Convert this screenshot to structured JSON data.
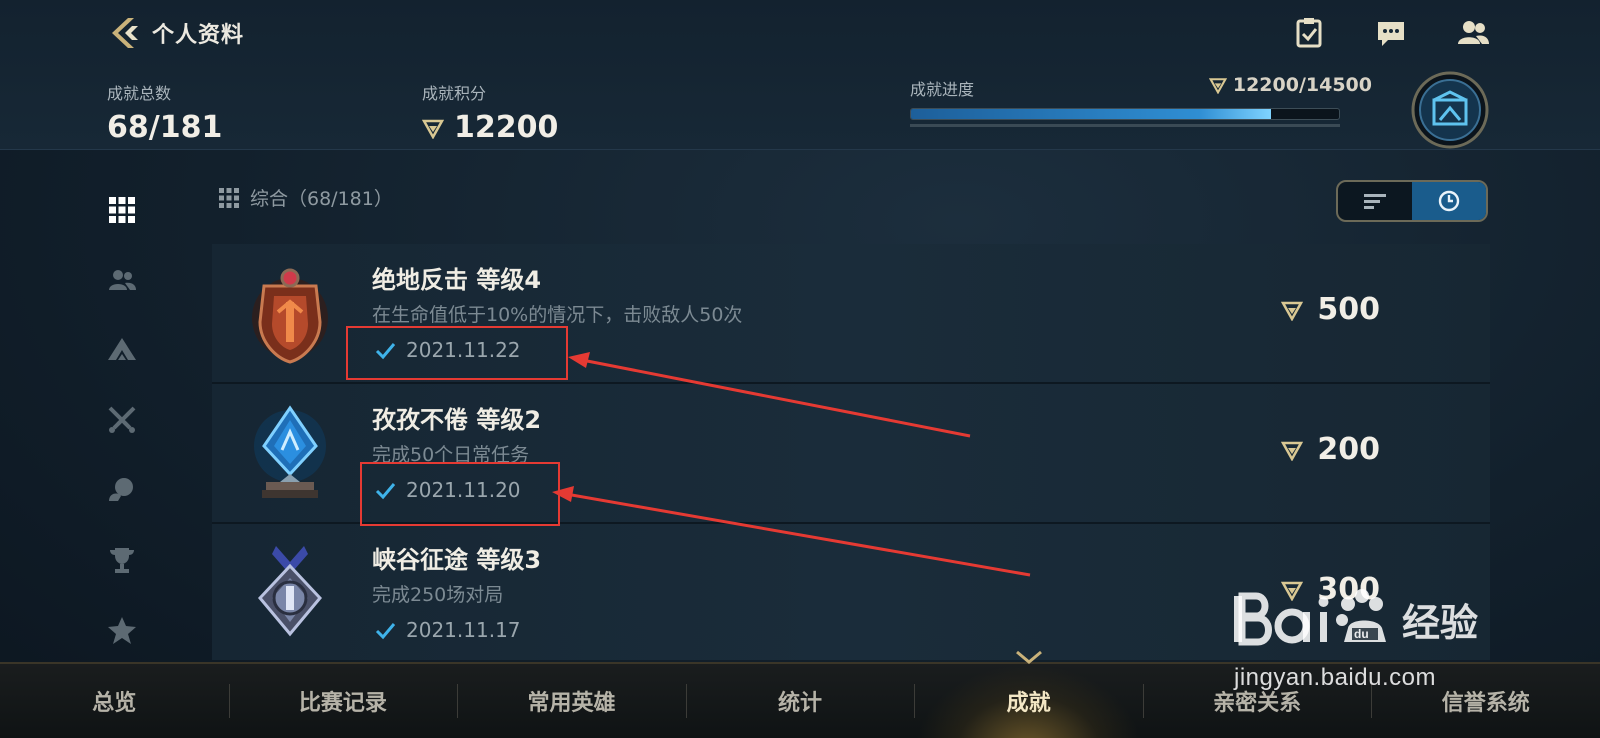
{
  "header": {
    "title": "个人资料",
    "icons": [
      "task-check-icon",
      "chat-icon",
      "friends-icon"
    ]
  },
  "stats": {
    "total_label": "成就总数",
    "total_value": "68/181",
    "points_label": "成就积分",
    "points_value": "12200",
    "progress_label": "成就进度",
    "progress_text": "12200/14500",
    "progress_fraction": 0.841
  },
  "sidebar": {
    "items": [
      "grid-icon",
      "team-icon",
      "rank-up-icon",
      "crossed-swords-icon",
      "social-icon",
      "trophy-icon",
      "star-icon"
    ],
    "active_index": 0
  },
  "filter": {
    "label": "综合（68/181）"
  },
  "sort_toggle": {
    "options": [
      "sort-list-icon",
      "clock-icon"
    ],
    "active_index": 1
  },
  "achievements": [
    {
      "title": "绝地反击  等级4",
      "desc": "在生命值低于10%的情况下，击败敌人50次",
      "date": "2021.11.22",
      "points": "500",
      "badge_color": "#b54a2b"
    },
    {
      "title": "孜孜不倦  等级2",
      "desc": "完成50个日常任务",
      "date": "2021.11.20",
      "points": "200",
      "badge_color": "#2b8fe0"
    },
    {
      "title": "峡谷征途  等级3",
      "desc": "完成250场对局",
      "date": "2021.11.17",
      "points": "300",
      "badge_color": "#7a86a8"
    }
  ],
  "tabs": {
    "items": [
      "总览",
      "比赛记录",
      "常用英雄",
      "统计",
      "成就",
      "亲密关系",
      "信誉系统"
    ],
    "active_index": 4
  },
  "watermark": {
    "url": "jingyan.baidu.com",
    "logo_text": "Bai经验"
  },
  "colors": {
    "accent_blue": "#2f8ed3",
    "gold": "#c9b27a",
    "annotation_red": "#e53a33"
  }
}
